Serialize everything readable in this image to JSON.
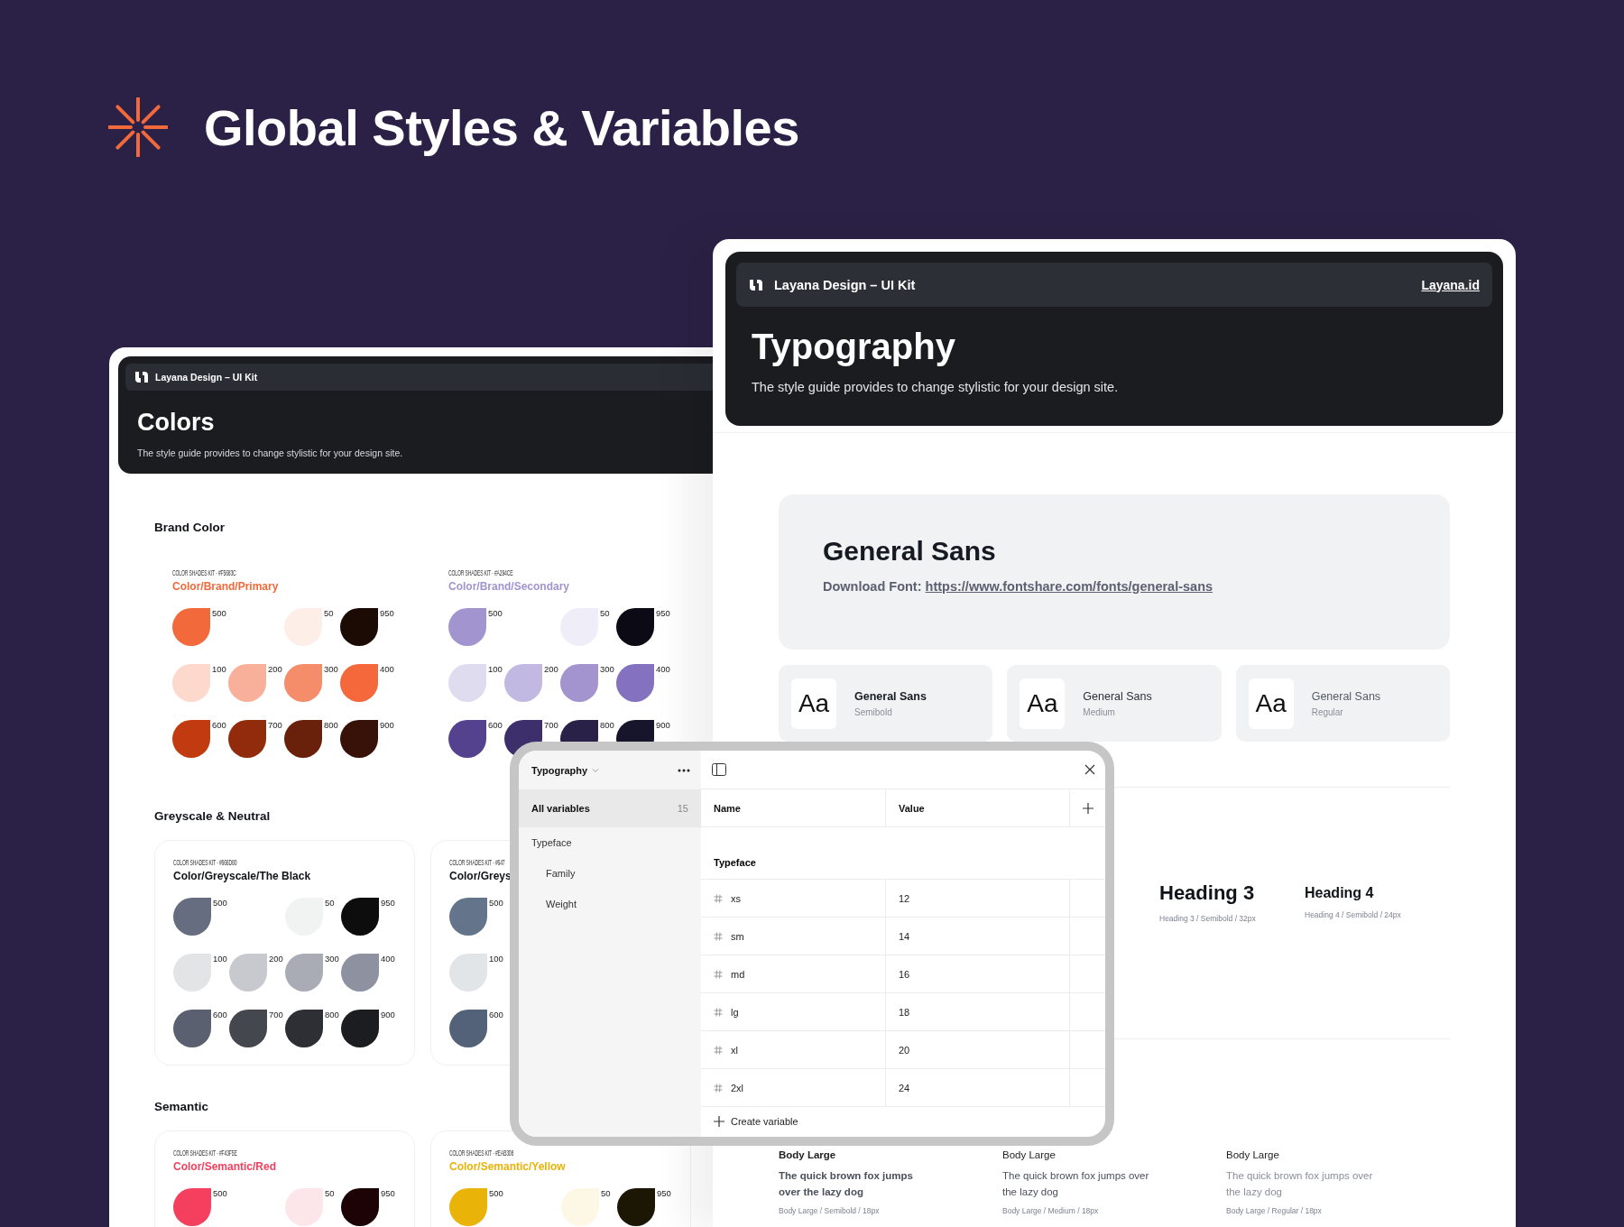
{
  "header": {
    "title": "Global Styles & Variables"
  },
  "colors_page": {
    "brand": "Layana Design – UI Kit",
    "title": "Colors",
    "description": "The style guide provides to change stylistic for your design site.",
    "sections": [
      {
        "title": "Brand Color",
        "kind": "plain",
        "groups": [
          {
            "kit_label": "COLOR SHADES KIT - #F5683C",
            "name": "Color/Brand/Primary",
            "color": "#f26a3c",
            "swatch_rows": [
              [
                {
                  "shade": "500",
                  "color": "#f26a3c"
                },
                {
                  "shade": "50",
                  "color": "#fdeee8"
                },
                {
                  "shade": "950",
                  "color": "#1c0a04"
                }
              ],
              [
                {
                  "shade": "100",
                  "color": "#fdd8cc"
                },
                {
                  "shade": "200",
                  "color": "#f8b09a"
                },
                {
                  "shade": "300",
                  "color": "#f58d6b"
                },
                {
                  "shade": "400",
                  "color": "#f4683b"
                }
              ],
              [
                {
                  "shade": "600",
                  "color": "#c23a10"
                },
                {
                  "shade": "700",
                  "color": "#912b0c"
                },
                {
                  "shade": "800",
                  "color": "#69210c"
                },
                {
                  "shade": "900",
                  "color": "#381109"
                }
              ]
            ]
          },
          {
            "kit_label": "COLOR SHADES KIT - #A294CE",
            "name": "Color/Brand/Secondary",
            "color": "#a294ce",
            "swatch_rows": [
              [
                {
                  "shade": "500",
                  "color": "#a294ce"
                },
                {
                  "shade": "50",
                  "color": "#efedf8"
                },
                {
                  "shade": "950",
                  "color": "#0c0a14"
                }
              ],
              [
                {
                  "shade": "100",
                  "color": "#e0dcf0"
                },
                {
                  "shade": "200",
                  "color": "#c2b9e3"
                },
                {
                  "shade": "300",
                  "color": "#a394cf"
                },
                {
                  "shade": "400",
                  "color": "#8471c0"
                }
              ],
              [
                {
                  "shade": "600",
                  "color": "#55428f"
                },
                {
                  "shade": "700",
                  "color": "#3c2f6b"
                },
                {
                  "shade": "800",
                  "color": "#2a2148"
                },
                {
                  "shade": "900",
                  "color": "#17152b"
                }
              ]
            ]
          }
        ]
      },
      {
        "title": "Greyscale & Neutral",
        "kind": "card",
        "groups": [
          {
            "kit_label": "COLOR SHADES KIT - #666D80",
            "name": "Color/Greyscale/The Black",
            "color": "#111318",
            "swatch_rows": [
              [
                {
                  "shade": "500",
                  "color": "#666d80"
                },
                {
                  "shade": "50",
                  "color": "#f1f2f2"
                },
                {
                  "shade": "950",
                  "color": "#0d0d0e"
                }
              ],
              [
                {
                  "shade": "100",
                  "color": "#e3e4e6"
                },
                {
                  "shade": "200",
                  "color": "#c7c9cf"
                },
                {
                  "shade": "300",
                  "color": "#a9acb5"
                },
                {
                  "shade": "400",
                  "color": "#8d91a0"
                }
              ],
              [
                {
                  "shade": "600",
                  "color": "#5b6070"
                },
                {
                  "shade": "700",
                  "color": "#45474f"
                },
                {
                  "shade": "800",
                  "color": "#2e2f35"
                },
                {
                  "shade": "900",
                  "color": "#1c1d20"
                }
              ]
            ]
          },
          {
            "kit_label": "COLOR SHADES KIT - #647",
            "name": "Color/Greys",
            "color": "#111318",
            "swatch_rows": [
              [
                {
                  "shade": "500",
                  "color": "#64748b"
                }
              ],
              [
                {
                  "shade": "100",
                  "color": "#e2e5e8"
                }
              ],
              [
                {
                  "shade": "600",
                  "color": "#536278"
                }
              ]
            ]
          }
        ]
      },
      {
        "title": "Semantic",
        "kind": "card",
        "groups": [
          {
            "kit_label": "COLOR SHADES KIT - #F43F5E",
            "name": "Color/Semantic/Red",
            "color": "#f43f5e",
            "swatch_rows": [
              [
                {
                  "shade": "500",
                  "color": "#f43f5e"
                },
                {
                  "shade": "50",
                  "color": "#fde6ea"
                },
                {
                  "shade": "950",
                  "color": "#1d0206"
                }
              ]
            ]
          },
          {
            "kit_label": "COLOR SHADES KIT - #EAB308",
            "name": "Color/Semantic/Yellow",
            "color": "#eab308",
            "swatch_rows": [
              [
                {
                  "shade": "500",
                  "color": "#eab308"
                },
                {
                  "shade": "50",
                  "color": "#fdf7e6"
                },
                {
                  "shade": "950",
                  "color": "#1c1705"
                }
              ]
            ]
          }
        ]
      }
    ]
  },
  "typography_page": {
    "brand": "Layana Design – UI Kit",
    "link": "Layana.id",
    "title": "Typography",
    "description": "The style guide provides to change stylistic for your design site.",
    "font_box": {
      "name": "General Sans",
      "download_label": "Download Font:",
      "url": "https://www.fontshare.com/fonts/general-sans"
    },
    "weights": [
      {
        "sample": "Aa",
        "name": "General Sans",
        "weight": "Semibold",
        "kind": "semibold"
      },
      {
        "sample": "Aa",
        "name": "General Sans",
        "weight": "Medium",
        "kind": "medium"
      },
      {
        "sample": "Aa",
        "name": "General Sans",
        "weight": "Regular",
        "kind": "regular"
      }
    ],
    "headings": [
      {
        "title": "Heading 3",
        "caption": "Heading 3 / Semibold / 32px",
        "kind": "h3"
      },
      {
        "title": "Heading 4",
        "caption": "Heading 4 / Semibold / 24px",
        "kind": "h4"
      }
    ],
    "body_samples": [
      {
        "title": "Body Large",
        "text": "The quick brown fox jumps over the lazy dog",
        "caption": "Body Large / Semibold / 18px",
        "kind": "semibold"
      },
      {
        "title": "Body Large",
        "text": "The quick brown fox jumps over the lazy dog",
        "caption": "Body Large / Medium / 18px",
        "kind": "medium"
      },
      {
        "title": "Body Large",
        "text": "The quick brown fox jumps over the lazy dog",
        "caption": "Body Large / Regular / 18px",
        "kind": "regular"
      }
    ]
  },
  "variables_dialog": {
    "collection": "Typography",
    "sidebar": [
      {
        "label": "All variables",
        "count": "15",
        "selected": true
      },
      {
        "label": "Typeface",
        "selected": false,
        "children": [
          {
            "label": "Family",
            "selected": false
          },
          {
            "label": "Weight",
            "selected": false
          }
        ]
      }
    ],
    "columns": [
      "Name",
      "Value"
    ],
    "groups": [
      {
        "title": "Typeface",
        "rows": [
          {
            "name": "xs",
            "value": "12"
          },
          {
            "name": "sm",
            "value": "14"
          },
          {
            "name": "md",
            "value": "16"
          },
          {
            "name": "lg",
            "value": "18"
          },
          {
            "name": "xl",
            "value": "20"
          },
          {
            "name": "2xl",
            "value": "24"
          }
        ]
      }
    ],
    "create_label": "Create variable"
  }
}
